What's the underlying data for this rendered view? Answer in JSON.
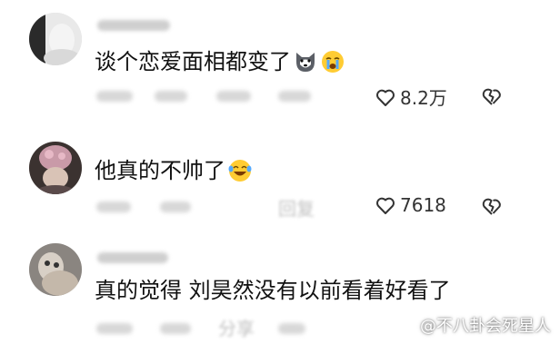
{
  "comments": [
    {
      "text": "谈个恋爱面相都变了",
      "emojis": [
        "husky-dog-emoji",
        "crying-face-emoji"
      ],
      "likes": "8.2万"
    },
    {
      "text": "他真的不帅了",
      "emojis": [
        "laughing-tears-emoji"
      ],
      "likes": "7618",
      "reply_label": "回复"
    },
    {
      "text": "真的觉得 刘昊然没有以前看着好看了",
      "emojis": [],
      "share_label": "分享"
    }
  ],
  "watermark": {
    "text": "@不八卦会死星人"
  },
  "colors": {
    "text": "#111111",
    "meta": "#b5b5b5",
    "icon": "#333333"
  }
}
